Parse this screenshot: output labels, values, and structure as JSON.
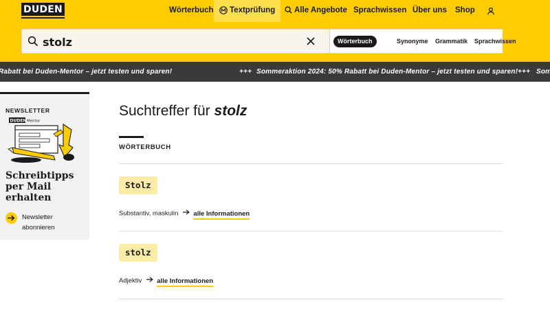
{
  "header": {
    "logo": "DUDEN",
    "nav": [
      {
        "label": "Wörterbuch"
      },
      {
        "label": "Textprüfung"
      },
      {
        "label": "Alle Angebote"
      },
      {
        "label": "Sprachwissen"
      },
      {
        "label": "Über uns"
      },
      {
        "label": "Shop"
      }
    ]
  },
  "search": {
    "value": "stolz",
    "tabs": [
      {
        "label": "Wörterbuch",
        "active": true
      },
      {
        "label": "Synonyme"
      },
      {
        "label": "Grammatik"
      },
      {
        "label": "Sprachwissen"
      }
    ]
  },
  "ticker": {
    "text": "Sommeraktion 2024: 50% Rabatt bei Duden-Mentor – jetzt testen und sparen!",
    "separator": "+++"
  },
  "sidebar": {
    "kicker": "NEWSLETTER",
    "logo_word": "DUDEN",
    "logo_sub": "Mentor",
    "heading": "Schreibtipps per Mail erhalten",
    "cta": "Newsletter abonnieren"
  },
  "main": {
    "title_prefix": "Suchtreffer für",
    "title_term": "stolz",
    "section": "WÖRTERBUCH",
    "entries": [
      {
        "word": "Stolz",
        "meta": "Substantiv, maskulin",
        "link": "alle Informationen"
      },
      {
        "word": "stolz",
        "meta": "Adjektiv",
        "link": "alle Informationen"
      }
    ]
  },
  "colors": {
    "brand_yellow": "#ffcc00",
    "dark": "#1a1a1a",
    "ticker_bg": "#3a3a3a",
    "highlight": "#fdeba8"
  }
}
